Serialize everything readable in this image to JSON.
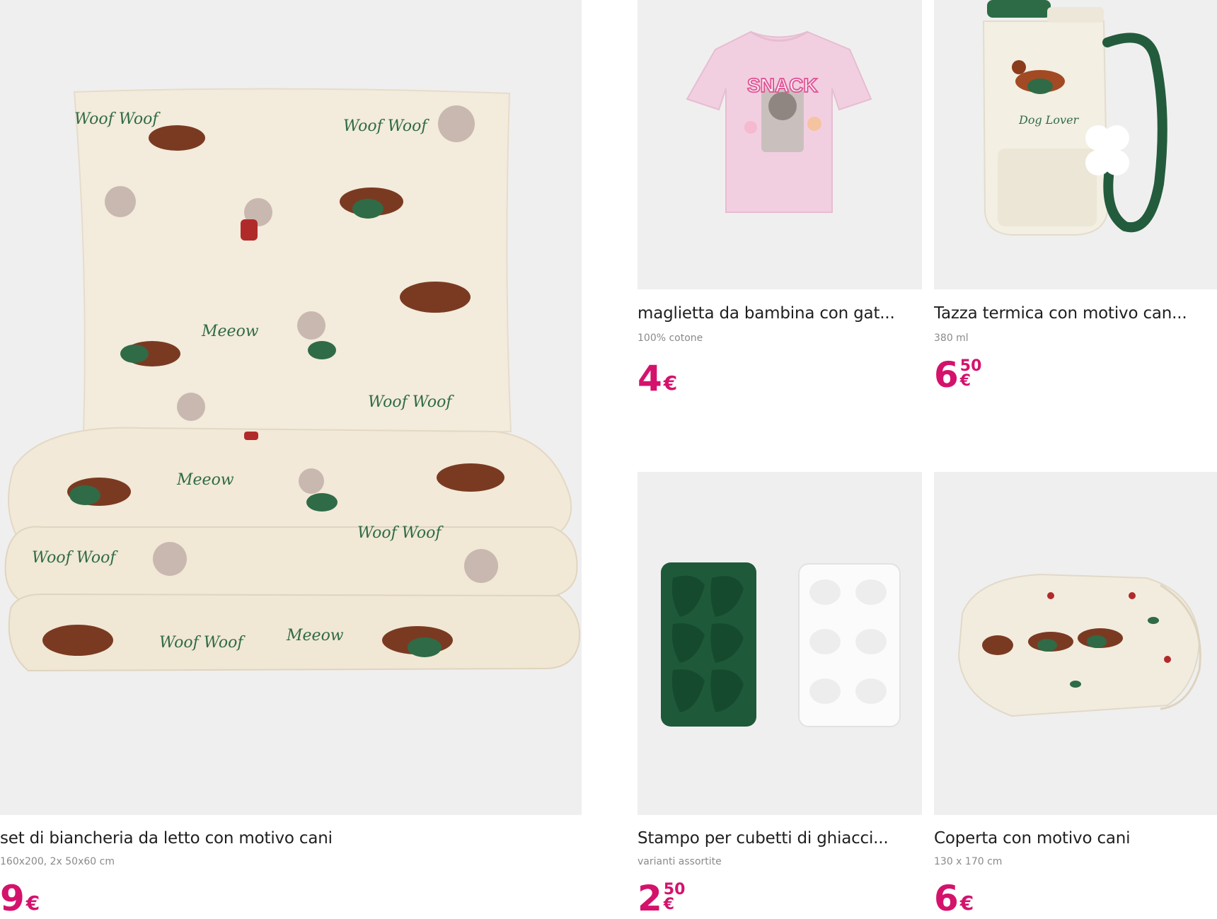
{
  "products": [
    {
      "title": "set di biancheria da letto con motivo cani",
      "subtitle": "160x200, 2x 50x60 cm",
      "price_int": "9",
      "price_dec": "",
      "currency": "€"
    },
    {
      "title": "maglietta da bambina con gat...",
      "subtitle": "100% cotone",
      "price_int": "4",
      "price_dec": "",
      "currency": "€"
    },
    {
      "title": "Tazza termica con motivo can...",
      "subtitle": "380 ml",
      "price_int": "6",
      "price_dec": "50",
      "currency": "€"
    },
    {
      "title": "Stampo per cubetti di ghiacci...",
      "subtitle": "varianti assortite",
      "price_int": "2",
      "price_dec": "50",
      "currency": "€"
    },
    {
      "title": "Coperta con motivo cani",
      "subtitle": "130 x 170 cm",
      "price_int": "6",
      "price_dec": "",
      "currency": "€"
    }
  ],
  "artwork": {
    "bedding_text_a": "Woof Woof",
    "bedding_text_b": "Meeow",
    "tshirt_print": "SNACK",
    "mug_text": "Dog Lover"
  },
  "colors": {
    "price": "#d4126c",
    "tile_bg": "#f0efef",
    "accent_green": "#1e5a3a"
  }
}
